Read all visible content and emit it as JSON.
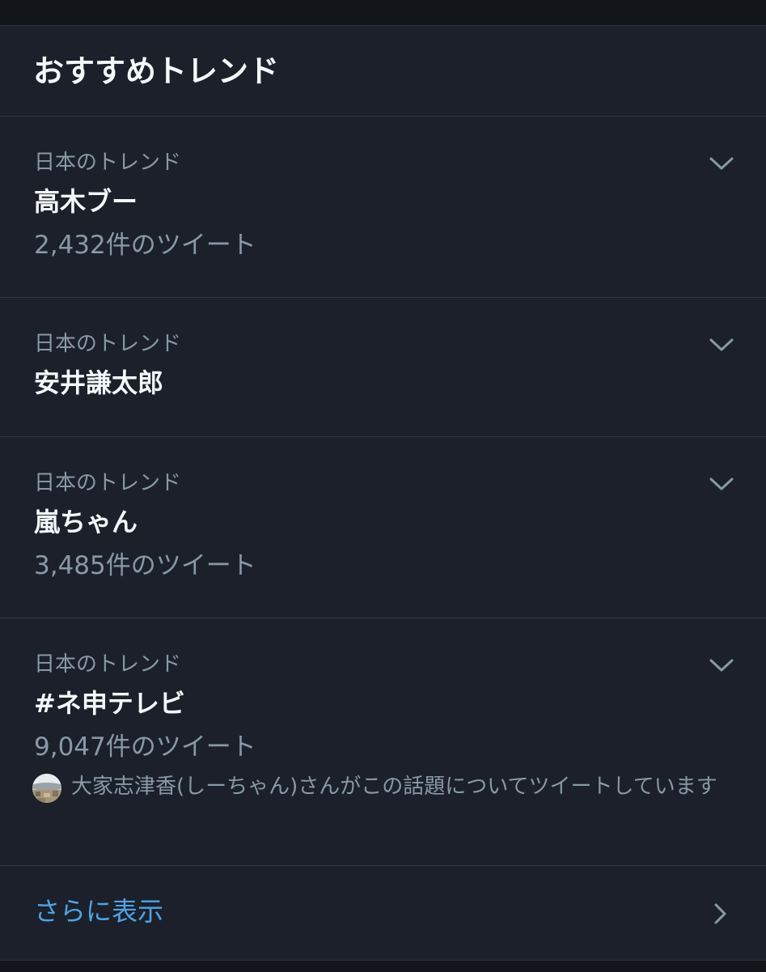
{
  "panel": {
    "title": "おすすめトレンド"
  },
  "trends": [
    {
      "context": "日本のトレンド",
      "name": "高木ブー",
      "count": "2,432件のツイート",
      "menu_icon": "chevron-down-icon"
    },
    {
      "context": "日本のトレンド",
      "name": "安井謙太郎",
      "menu_icon": "chevron-down-icon"
    },
    {
      "context": "日本のトレンド",
      "name": "嵐ちゃん",
      "count": "3,485件のツイート",
      "menu_icon": "chevron-down-icon"
    },
    {
      "context": "日本のトレンド",
      "name": "#ネ申テレビ",
      "count": "9,047件のツイート",
      "menu_icon": "chevron-down-icon",
      "social": {
        "avatar": "user-avatar",
        "text": "大家志津香(しーちゃん)さんがこの話題についてツイートしています"
      }
    }
  ],
  "footer": {
    "show_more": "さらに表示",
    "arrow_icon": "chevron-right-icon"
  },
  "colors": {
    "background": "#1b202a",
    "outer_background": "#14171c",
    "divider": "#323a45",
    "primary_text": "#f5f8fa",
    "secondary_text": "#8899a6",
    "link": "#4fa3e6"
  }
}
